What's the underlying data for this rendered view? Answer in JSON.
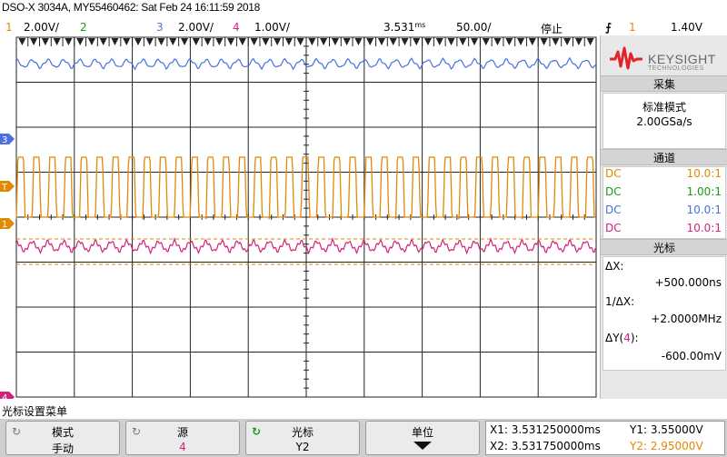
{
  "title": "DSO-X 3034A, MY55460462: Sat Feb 24 16:11:59 2018",
  "channels": {
    "ch1_num": "1",
    "ch1_scale": "2.00V/",
    "ch2_num": "2",
    "ch3_num": "3",
    "ch3_scale": "2.00V/",
    "ch4_num": "4",
    "ch4_scale": "1.00V/"
  },
  "timebase": {
    "delay": "3.531",
    "delay_unit": "ms",
    "scale": "50.00",
    "scale_unit": "/"
  },
  "run_state": "停止",
  "trigger": {
    "edge_icon": "rising-edge-icon",
    "source": "1",
    "level": "1.40V"
  },
  "brand": {
    "name": "KEYSIGHT",
    "sub": "TECHNOLOGIES"
  },
  "acquisition": {
    "header": "采集",
    "mode": "标准模式",
    "rate": "2.00GSa/s"
  },
  "channels_panel": {
    "header": "通道",
    "rows": [
      {
        "coupling": "DC",
        "probe": "10.0:1",
        "color": "#e08a00"
      },
      {
        "coupling": "DC",
        "probe": "1.00:1",
        "color": "#1a9a1a"
      },
      {
        "coupling": "DC",
        "probe": "10.0:1",
        "color": "#4a6fe0"
      },
      {
        "coupling": "DC",
        "probe": "10.0:1",
        "color": "#d4217e"
      }
    ]
  },
  "cursors": {
    "header": "光标",
    "dx_label": "ΔX:",
    "dx_value": "+500.000ns",
    "inv_dx_label": "1/ΔX:",
    "inv_dx_value": "+2.0000MHz",
    "dy_label_prefix": "ΔY(",
    "dy_label_ch": "4",
    "dy_label_suffix": "):",
    "dy_value": "-600.00mV"
  },
  "menu": {
    "title": "光标设置菜单",
    "keys": [
      {
        "label": "模式",
        "value": "手动"
      },
      {
        "label": "源",
        "value": "4"
      },
      {
        "label": "光标",
        "value": "Y2"
      },
      {
        "label": "单位",
        "value": ""
      }
    ]
  },
  "readout": {
    "x1": "X1: 3.531250000ms",
    "x2": "X2: 3.531750000ms",
    "y1": "Y1: 3.55000V",
    "y2": "Y2: 2.95000V"
  },
  "colors": {
    "ch1": "#e08a00",
    "ch2": "#1a9a1a",
    "ch3": "#4a6fe0",
    "ch4": "#d4217e",
    "trigger_marker": "#e08a00",
    "grid": "#222222"
  },
  "markers": {
    "ch3": "3",
    "ch1": "1",
    "ch4": "4",
    "trig": "T"
  }
}
